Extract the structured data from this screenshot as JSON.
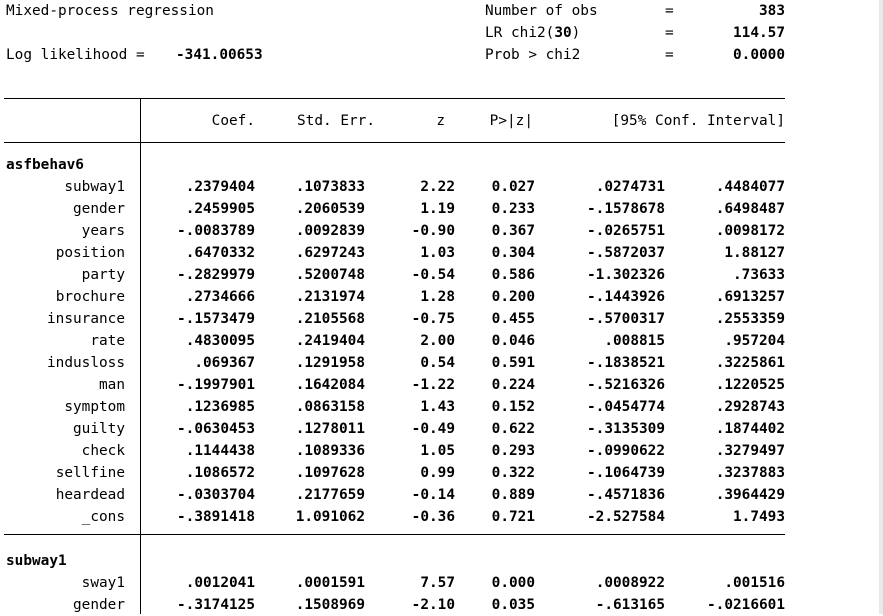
{
  "header": {
    "title": "Mixed-process regression",
    "loglik_label": "Log likelihood =",
    "loglik_value": "-341.00653",
    "stats": [
      {
        "label": "Number of obs",
        "eq": "=",
        "value": "383",
        "bold": ""
      },
      {
        "label": "LR chi2(",
        "bold": "30",
        "tail": ")",
        "eq": "=",
        "value": "114.57"
      },
      {
        "label": "Prob > chi2",
        "eq": "=",
        "value": "0.0000",
        "bold": ""
      }
    ]
  },
  "columns": {
    "coef": "Coef.",
    "se": "Std. Err.",
    "z": "z",
    "p": "P>|z|",
    "ci": "[95% Conf. Interval]"
  },
  "equations": [
    {
      "name": "asfbehav6",
      "rows": [
        {
          "var": "subway1",
          "coef": ".2379404",
          "se": ".1073833",
          "z": "2.22",
          "p": "0.027",
          "lo": ".0274731",
          "hi": ".4484077"
        },
        {
          "var": "gender",
          "coef": ".2459905",
          "se": ".2060539",
          "z": "1.19",
          "p": "0.233",
          "lo": "-.1578678",
          "hi": ".6498487"
        },
        {
          "var": "years",
          "coef": "-.0083789",
          "se": ".0092839",
          "z": "-0.90",
          "p": "0.367",
          "lo": "-.0265751",
          "hi": ".0098172"
        },
        {
          "var": "position",
          "coef": ".6470332",
          "se": ".6297243",
          "z": "1.03",
          "p": "0.304",
          "lo": "-.5872037",
          "hi": "1.88127"
        },
        {
          "var": "party",
          "coef": "-.2829979",
          "se": ".5200748",
          "z": "-0.54",
          "p": "0.586",
          "lo": "-1.302326",
          "hi": ".73633"
        },
        {
          "var": "brochure",
          "coef": ".2734666",
          "se": ".2131974",
          "z": "1.28",
          "p": "0.200",
          "lo": "-.1443926",
          "hi": ".6913257"
        },
        {
          "var": "insurance",
          "coef": "-.1573479",
          "se": ".2105568",
          "z": "-0.75",
          "p": "0.455",
          "lo": "-.5700317",
          "hi": ".2553359"
        },
        {
          "var": "rate",
          "coef": ".4830095",
          "se": ".2419404",
          "z": "2.00",
          "p": "0.046",
          "lo": ".008815",
          "hi": ".957204"
        },
        {
          "var": "indusloss",
          "coef": ".069367",
          "se": ".1291958",
          "z": "0.54",
          "p": "0.591",
          "lo": "-.1838521",
          "hi": ".3225861"
        },
        {
          "var": "man",
          "coef": "-.1997901",
          "se": ".1642084",
          "z": "-1.22",
          "p": "0.224",
          "lo": "-.5216326",
          "hi": ".1220525"
        },
        {
          "var": "symptom",
          "coef": ".1236985",
          "se": ".0863158",
          "z": "1.43",
          "p": "0.152",
          "lo": "-.0454774",
          "hi": ".2928743"
        },
        {
          "var": "guilty",
          "coef": "-.0630453",
          "se": ".1278011",
          "z": "-0.49",
          "p": "0.622",
          "lo": "-.3135309",
          "hi": ".1874402"
        },
        {
          "var": "check",
          "coef": ".1144438",
          "se": ".1089336",
          "z": "1.05",
          "p": "0.293",
          "lo": "-.0990622",
          "hi": ".3279497"
        },
        {
          "var": "sellfine",
          "coef": ".1086572",
          "se": ".1097628",
          "z": "0.99",
          "p": "0.322",
          "lo": "-.1064739",
          "hi": ".3237883"
        },
        {
          "var": "heardead",
          "coef": "-.0303704",
          "se": ".2177659",
          "z": "-0.14",
          "p": "0.889",
          "lo": "-.4571836",
          "hi": ".3964429"
        },
        {
          "var": "_cons",
          "coef": "-.3891418",
          "se": "1.091062",
          "z": "-0.36",
          "p": "0.721",
          "lo": "-2.527584",
          "hi": "1.7493"
        }
      ]
    },
    {
      "name": "subway1",
      "rows": [
        {
          "var": "sway1",
          "coef": ".0012041",
          "se": ".0001591",
          "z": "7.57",
          "p": "0.000",
          "lo": ".0008922",
          "hi": ".001516"
        },
        {
          "var": "gender",
          "coef": "-.3174125",
          "se": ".1508969",
          "z": "-2.10",
          "p": "0.035",
          "lo": "-.613165",
          "hi": "-.0216601"
        }
      ]
    }
  ]
}
